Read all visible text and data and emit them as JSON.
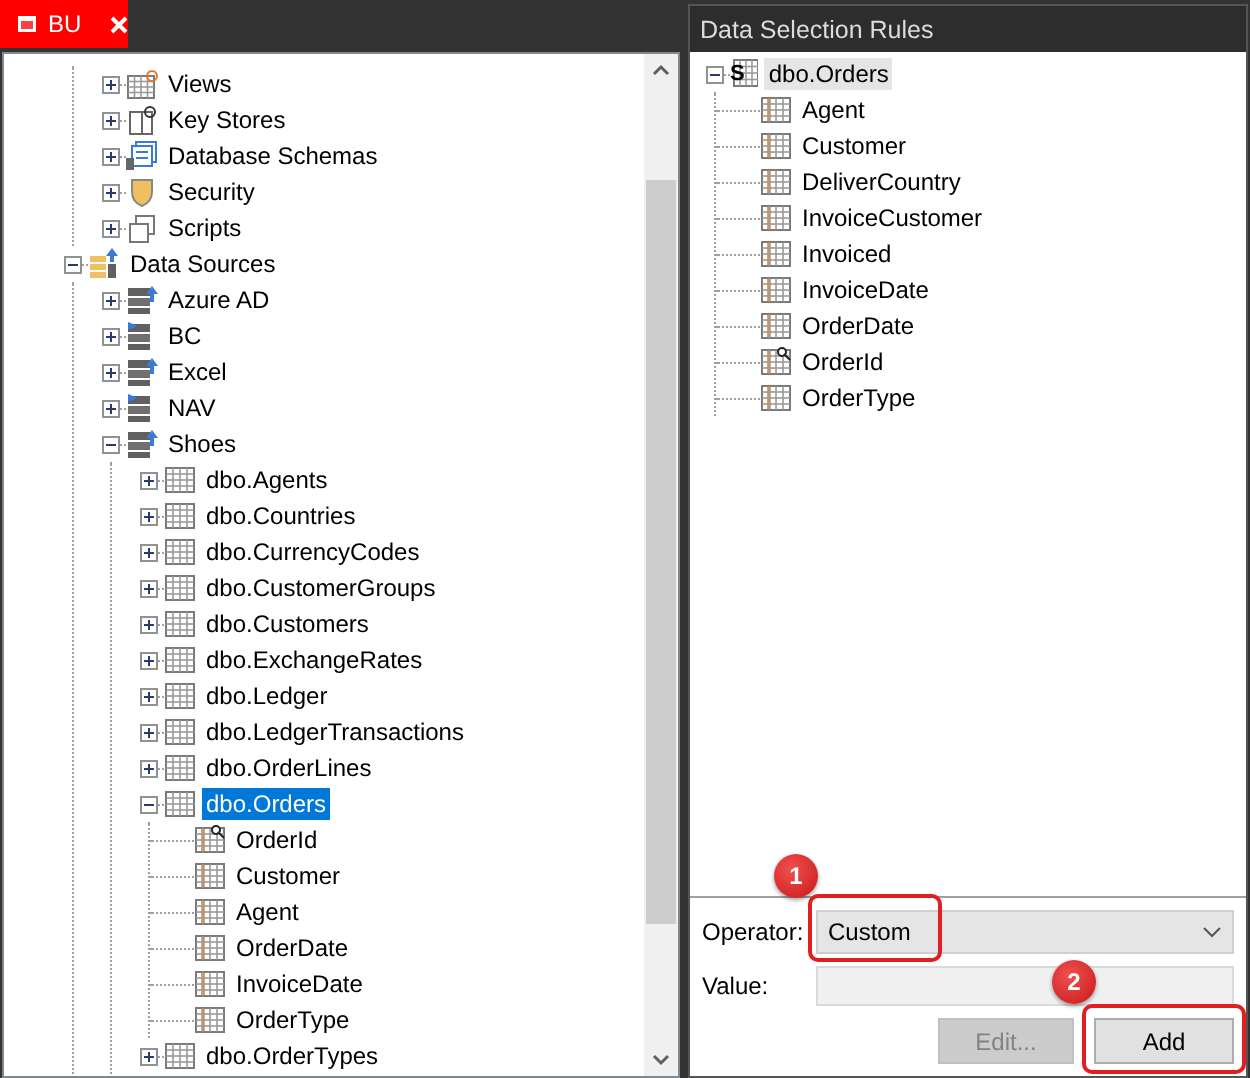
{
  "document_tab": {
    "title": "BU"
  },
  "explorer_tree": [
    {
      "kind": "hidden_parent",
      "children": [
        {
          "label": "Views",
          "kind": "views",
          "expanded": false,
          "selected": false
        },
        {
          "label": "Key Stores",
          "kind": "key_store",
          "expanded": false,
          "selected": false
        },
        {
          "label": "Database Schemas",
          "kind": "schema",
          "expanded": false,
          "selected": false
        },
        {
          "label": "Security",
          "kind": "security",
          "expanded": false,
          "selected": false
        },
        {
          "label": "Scripts",
          "kind": "scripts",
          "expanded": false,
          "selected": false
        }
      ]
    },
    {
      "label": "Data Sources",
      "kind": "data_sources",
      "expanded": true,
      "selected": false,
      "children": [
        {
          "label": "Azure AD",
          "kind": "source",
          "expanded": false,
          "selected": false
        },
        {
          "label": "BC",
          "kind": "source_flag",
          "expanded": false,
          "selected": false
        },
        {
          "label": "Excel",
          "kind": "source",
          "expanded": false,
          "selected": false
        },
        {
          "label": "NAV",
          "kind": "source_flag",
          "expanded": false,
          "selected": false
        },
        {
          "label": "Shoes",
          "kind": "source",
          "expanded": true,
          "selected": false,
          "children": [
            {
              "label": "dbo.Agents",
              "kind": "table",
              "expanded": false,
              "selected": false
            },
            {
              "label": "dbo.Countries",
              "kind": "table",
              "expanded": false,
              "selected": false
            },
            {
              "label": "dbo.CurrencyCodes",
              "kind": "table",
              "expanded": false,
              "selected": false
            },
            {
              "label": "dbo.CustomerGroups",
              "kind": "table",
              "expanded": false,
              "selected": false
            },
            {
              "label": "dbo.Customers",
              "kind": "table",
              "expanded": false,
              "selected": false
            },
            {
              "label": "dbo.ExchangeRates",
              "kind": "table",
              "expanded": false,
              "selected": false
            },
            {
              "label": "dbo.Ledger",
              "kind": "table",
              "expanded": false,
              "selected": false
            },
            {
              "label": "dbo.LedgerTransactions",
              "kind": "table",
              "expanded": false,
              "selected": false
            },
            {
              "label": "dbo.OrderLines",
              "kind": "table",
              "expanded": false,
              "selected": false
            },
            {
              "label": "dbo.Orders",
              "kind": "table",
              "expanded": true,
              "selected": true,
              "children": [
                {
                  "label": "OrderId",
                  "kind": "key_column",
                  "selected": false
                },
                {
                  "label": "Customer",
                  "kind": "column",
                  "selected": false
                },
                {
                  "label": "Agent",
                  "kind": "column",
                  "selected": false
                },
                {
                  "label": "OrderDate",
                  "kind": "column",
                  "selected": false
                },
                {
                  "label": "InvoiceDate",
                  "kind": "column",
                  "selected": false
                },
                {
                  "label": "OrderType",
                  "kind": "column",
                  "selected": false
                }
              ]
            },
            {
              "label": "dbo.OrderTypes",
              "kind": "table",
              "expanded": false,
              "selected": false
            }
          ]
        }
      ]
    }
  ],
  "rules_panel": {
    "title": "Data Selection Rules",
    "tree": [
      {
        "label": "dbo.Orders",
        "kind": "table_rule",
        "badge": "S",
        "expanded": true,
        "selected": true,
        "children": [
          {
            "label": "Agent",
            "kind": "column",
            "selected": false
          },
          {
            "label": "Customer",
            "kind": "column",
            "selected": false
          },
          {
            "label": "DeliverCountry",
            "kind": "column",
            "selected": false
          },
          {
            "label": "InvoiceCustomer",
            "kind": "column",
            "selected": false
          },
          {
            "label": "Invoiced",
            "kind": "column",
            "selected": false
          },
          {
            "label": "InvoiceDate",
            "kind": "column",
            "selected": false
          },
          {
            "label": "OrderDate",
            "kind": "column",
            "selected": false
          },
          {
            "label": "OrderId",
            "kind": "key_column",
            "selected": false
          },
          {
            "label": "OrderType",
            "kind": "column",
            "selected": false
          }
        ]
      }
    ],
    "operator": {
      "label": "Operator:",
      "value": "Custom",
      "callout": "1"
    },
    "value": {
      "label": "Value:",
      "disabled": true
    },
    "buttons": [
      {
        "label": "Edit...",
        "disabled": true
      },
      {
        "label": "Add",
        "disabled": false,
        "callout": "2"
      }
    ]
  }
}
